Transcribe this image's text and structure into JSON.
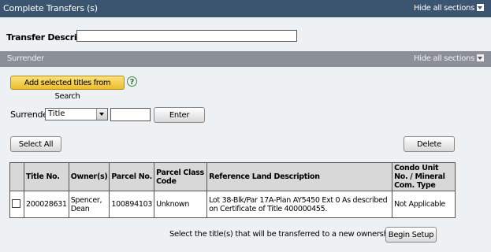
{
  "header": {
    "title": "Complete Transfers (s)",
    "hide_all": "Hide all sections"
  },
  "description": {
    "label": "Transfer Description",
    "value": ""
  },
  "surrender_section": {
    "title": "Surrender",
    "hide_all": "Hide all sections"
  },
  "add_button": "Add selected titles from Search",
  "help_icon": "?",
  "surrender_row": {
    "label": "Surrender:",
    "selected": "Title",
    "text_value": "",
    "enter_button": "Enter"
  },
  "select_all_button": "Select All",
  "delete_button": "Delete",
  "table": {
    "headers": [
      "",
      "Title No.",
      "Owner(s)",
      "Parcel No.",
      "Parcel Class Code",
      "Reference Land Description",
      "Condo Unit No. / Mineral Com. Type"
    ],
    "rows": [
      {
        "title_no": "200028631",
        "owner": "Spencer, Dean",
        "parcel_no": "100894103",
        "class_code": "Unknown",
        "land_desc": "Lot 38-Blk/Par 17A-Plan AY5450 Ext 0 As described on Certificate of Title 400000455.",
        "condo": "Not Applicable"
      }
    ]
  },
  "footer": {
    "note": "Select the title(s) that will be transferred to a new ownership structure.",
    "begin_setup_button": "Begin Setup"
  },
  "colors": {
    "header_bg": "#3b5470",
    "subheader_bg": "#8b9098",
    "add_button": "#ecbd2c"
  }
}
